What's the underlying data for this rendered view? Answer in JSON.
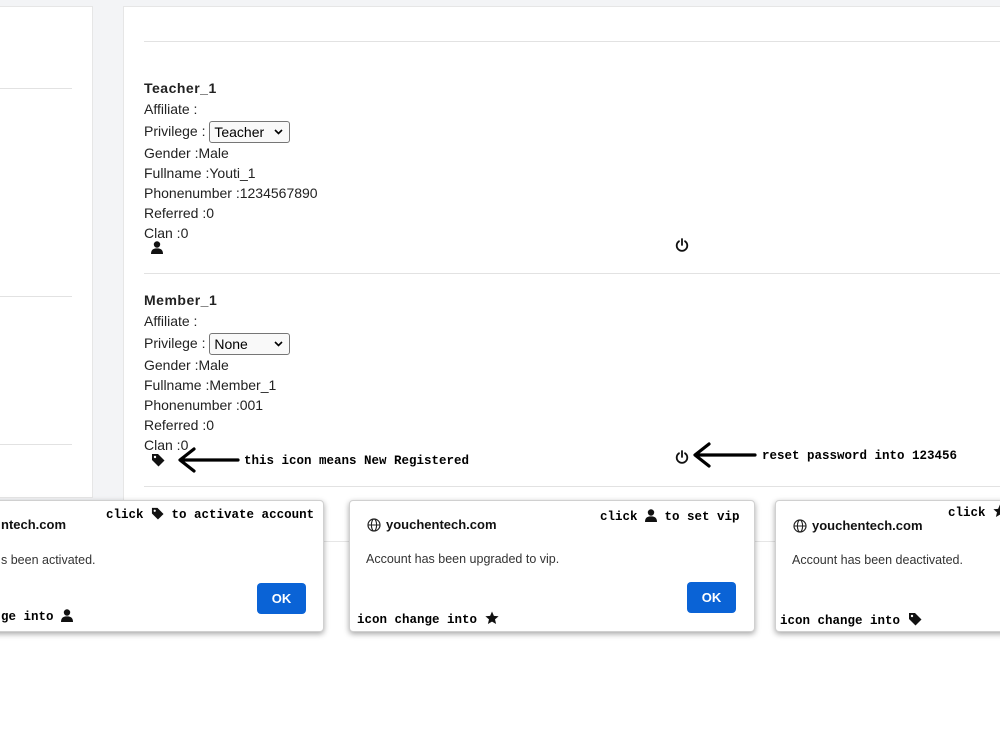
{
  "users": [
    {
      "name": "Teacher_1",
      "affiliate": "Affiliate :",
      "privilege_label": "Privilege :",
      "privilege_value": "Teacher",
      "gender": "Gender :Male",
      "fullname": "Fullname :Youti_1",
      "phone": "Phonenumber :1234567890",
      "referred": "Referred :0",
      "clan": "Clan :0",
      "status_icon": "user-icon",
      "action_icon": "power-icon"
    },
    {
      "name": "Member_1",
      "affiliate": "Affiliate :",
      "privilege_label": "Privilege :",
      "privilege_value": "None",
      "gender": "Gender :Male",
      "fullname": "Fullname :Member_1",
      "phone": "Phonenumber :001",
      "referred": "Referred :0",
      "clan": "Clan :0",
      "status_icon": "tag-icon",
      "action_icon": "power-icon"
    }
  ],
  "annotations": {
    "new_registered": "this icon means New Registered",
    "reset_password": "reset password into 123456"
  },
  "dialogs": [
    {
      "site": "ntech.com",
      "message": "s been activated.",
      "ok_label": "OK",
      "note_pre": "click",
      "note_post": "to activate account",
      "note_icon": "tag-icon",
      "change_text": "ge into",
      "change_icon": "user-icon"
    },
    {
      "site": "youchentech.com",
      "message": "Account has been upgraded to vip.",
      "ok_label": "OK",
      "note_pre": "click",
      "note_post": "to set vip",
      "note_icon": "user-icon",
      "change_text": "icon change into",
      "change_icon": "star-icon"
    },
    {
      "site": "youchentech.com",
      "message": "Account has been deactivated.",
      "note_pre": "click",
      "note_icon": "star-icon",
      "change_text": "icon change into",
      "change_icon": "tag-icon"
    }
  ],
  "colors": {
    "ok_button": "#0a63d6",
    "page_background": "#f3f4f6"
  }
}
